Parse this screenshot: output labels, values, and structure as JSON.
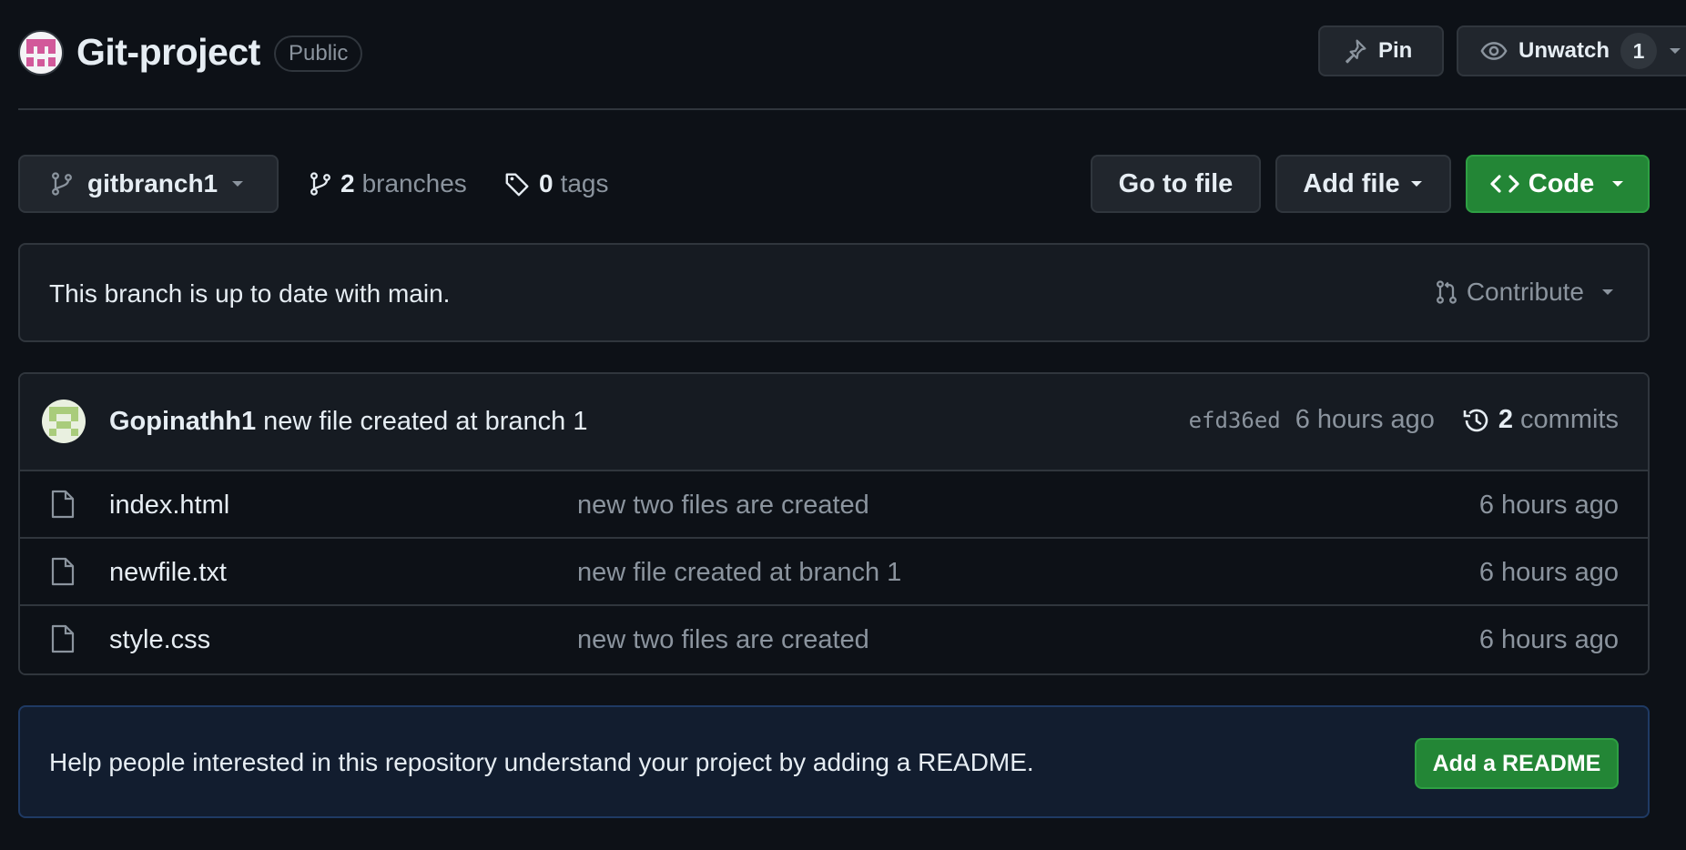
{
  "repo": {
    "name": "Git-project",
    "visibility": "Public"
  },
  "header_actions": {
    "pin_label": "Pin",
    "watch_label": "Unwatch",
    "watch_count": "1"
  },
  "toolbar": {
    "branch_name": "gitbranch1",
    "branches_count": "2",
    "branches_label": "branches",
    "tags_count": "0",
    "tags_label": "tags",
    "goto_file_label": "Go to file",
    "add_file_label": "Add file",
    "code_label": "Code"
  },
  "branch_status": {
    "text": "This branch is up to date with main.",
    "contribute_label": "Contribute"
  },
  "latest_commit": {
    "author": "Gopinathh1",
    "message": "new file created at branch 1",
    "sha": "efd36ed",
    "age": "6 hours ago",
    "commits_count": "2",
    "commits_label": "commits"
  },
  "files": [
    {
      "name": "index.html",
      "message": "new two files are created",
      "age": "6 hours ago"
    },
    {
      "name": "newfile.txt",
      "message": "new file created at branch 1",
      "age": "6 hours ago"
    },
    {
      "name": "style.css",
      "message": "new two files are created",
      "age": "6 hours ago"
    }
  ],
  "readme_banner": {
    "text": "Help people interested in this repository understand your project by adding a README.",
    "button_label": "Add a README"
  },
  "colors": {
    "background": "#0d1117",
    "surface": "#161b22",
    "border": "#30363d",
    "primary_button": "#238636",
    "text": "#e6edf3",
    "muted_text": "#8b949e"
  }
}
